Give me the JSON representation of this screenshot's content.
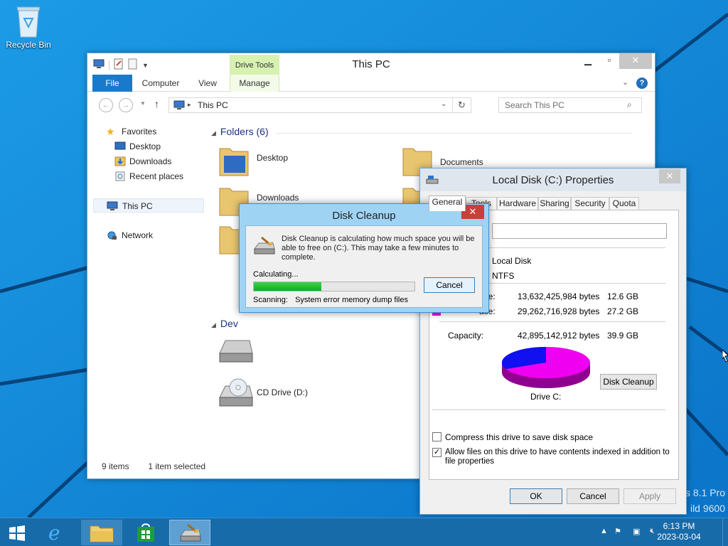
{
  "desktop": {
    "recycle_bin_label": "Recycle Bin",
    "watermark_line1": "s 8.1 Pro",
    "watermark_line2": "ild 9600"
  },
  "explorer": {
    "title": "This PC",
    "contextual_tab_group": "Drive Tools",
    "tabs": [
      "File",
      "Computer",
      "View",
      "Manage"
    ],
    "address": "This PC",
    "search_placeholder": "Search This PC",
    "nav": {
      "favorites": "Favorites",
      "desktop": "Desktop",
      "downloads": "Downloads",
      "recent_places": "Recent places",
      "this_pc": "This PC",
      "network": "Network"
    },
    "folders_group": "Folders (6)",
    "devices_group": "Dev",
    "folders": [
      "Desktop",
      "Documents",
      "Downloads"
    ],
    "drives": [
      "CD Drive (D:)"
    ],
    "status_items": "9 items",
    "status_selected": "1 item selected"
  },
  "properties": {
    "title": "Local Disk (C:) Properties",
    "tabs": [
      "General",
      "Tools",
      "Hardware",
      "Sharing",
      "Security",
      "Quota"
    ],
    "type_value": "Local Disk",
    "filesystem_value": "NTFS",
    "used_label": "ace:",
    "used_bytes": "13,632,425,984 bytes",
    "used_gb": "12.6 GB",
    "free_label": "ace:",
    "free_bytes": "29,262,716,928 bytes",
    "free_gb": "27.2 GB",
    "capacity_label": "Capacity:",
    "capacity_bytes": "42,895,142,912 bytes",
    "capacity_gb": "39.9 GB",
    "drive_label": "Drive C:",
    "disk_cleanup_button": "Disk Cleanup",
    "compress_label": "Compress this drive to save disk space",
    "index_label_line1": "Allow files on this drive to have contents indexed in addition to",
    "index_label_line2": "file properties",
    "compress_checked": false,
    "index_checked": true,
    "ok": "OK",
    "cancel": "Cancel",
    "apply": "Apply",
    "used_fraction": 0.318,
    "colors": {
      "used": "#1010f0",
      "free": "#f000f0"
    }
  },
  "cleanup": {
    "title": "Disk Cleanup",
    "message_line1": "Disk Cleanup is calculating how much space you will be",
    "message_line2": "able to free on  (C:). This may take a few minutes to",
    "message_line3": "complete.",
    "calculating": "Calculating...",
    "cancel": "Cancel",
    "scanning_label": "Scanning:",
    "scanning_item": "System error memory dump files",
    "progress": 0.42
  },
  "taskbar": {
    "time": "6:13 PM",
    "date": "2023-03-04"
  }
}
